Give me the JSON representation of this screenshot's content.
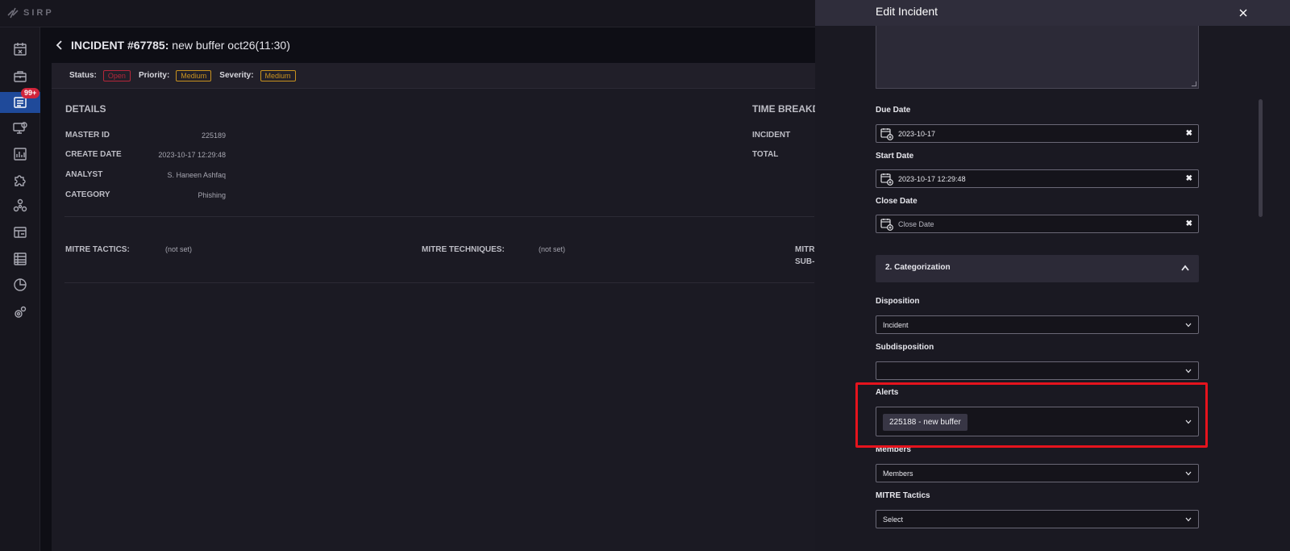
{
  "app": {
    "logo_text": "SIRP"
  },
  "sidebar": {
    "badge": "99+",
    "items": [
      {
        "icon": "calendar-x-icon"
      },
      {
        "icon": "briefcase-icon"
      },
      {
        "icon": "incidents-icon",
        "active": true
      },
      {
        "icon": "monitor-alert-icon"
      },
      {
        "icon": "chart-icon"
      },
      {
        "icon": "puzzle-icon"
      },
      {
        "icon": "network-icon"
      },
      {
        "icon": "dashboard-icon"
      },
      {
        "icon": "database-icon"
      },
      {
        "icon": "pie-chart-icon"
      },
      {
        "icon": "settings-icon"
      }
    ]
  },
  "incident": {
    "title_prefix": "INCIDENT #67785:",
    "title_name": "new buffer oct26(11:30)",
    "status_label": "Status:",
    "status_value": "Open",
    "priority_label": "Priority:",
    "priority_value": "Medium",
    "severity_label": "Severity:",
    "severity_value": "Medium",
    "details_heading": "DETAILS",
    "time_heading": "TIME BREAKD",
    "details": [
      {
        "label": "MASTER ID",
        "value": "225189"
      },
      {
        "label": "CREATE DATE",
        "value": "2023-10-17 12:29:48"
      },
      {
        "label": "ANALYST",
        "value": "S. Haneen Ashfaq"
      },
      {
        "label": "CATEGORY",
        "value": "Phishing"
      }
    ],
    "time_rows": [
      "INCIDENT",
      "TOTAL"
    ],
    "mitre_tactics_label": "MITRE TACTICS:",
    "mitre_tactics_value": "(not set)",
    "mitre_techniques_label": "MITRE TECHNIQUES:",
    "mitre_techniques_value": "(not set)",
    "mitre_sub_line1": "MITR",
    "mitre_sub_line2": "SUB-"
  },
  "drawer": {
    "title": "Edit Incident",
    "due_date_label": "Due Date",
    "due_date_value": "2023-10-17",
    "start_date_label": "Start Date",
    "start_date_value": "2023-10-17 12:29:48",
    "close_date_label": "Close Date",
    "close_date_placeholder": "Close Date",
    "clear_glyph": "✖",
    "section_title": "2. Categorization",
    "disposition_label": "Disposition",
    "disposition_value": "Incident",
    "subdisposition_label": "Subdisposition",
    "subdisposition_value": "",
    "alerts_label": "Alerts",
    "alerts_chip": "225188 - new buffer",
    "members_label": "Members",
    "members_placeholder": "Members",
    "mitre_tactics_label": "MITRE Tactics",
    "mitre_tactics_placeholder": "Select"
  },
  "colors": {
    "accent_blue": "#1f4a9a",
    "status_red": "#b5273a",
    "medium_amber": "#c8921f",
    "highlight_red": "#e5131d"
  }
}
